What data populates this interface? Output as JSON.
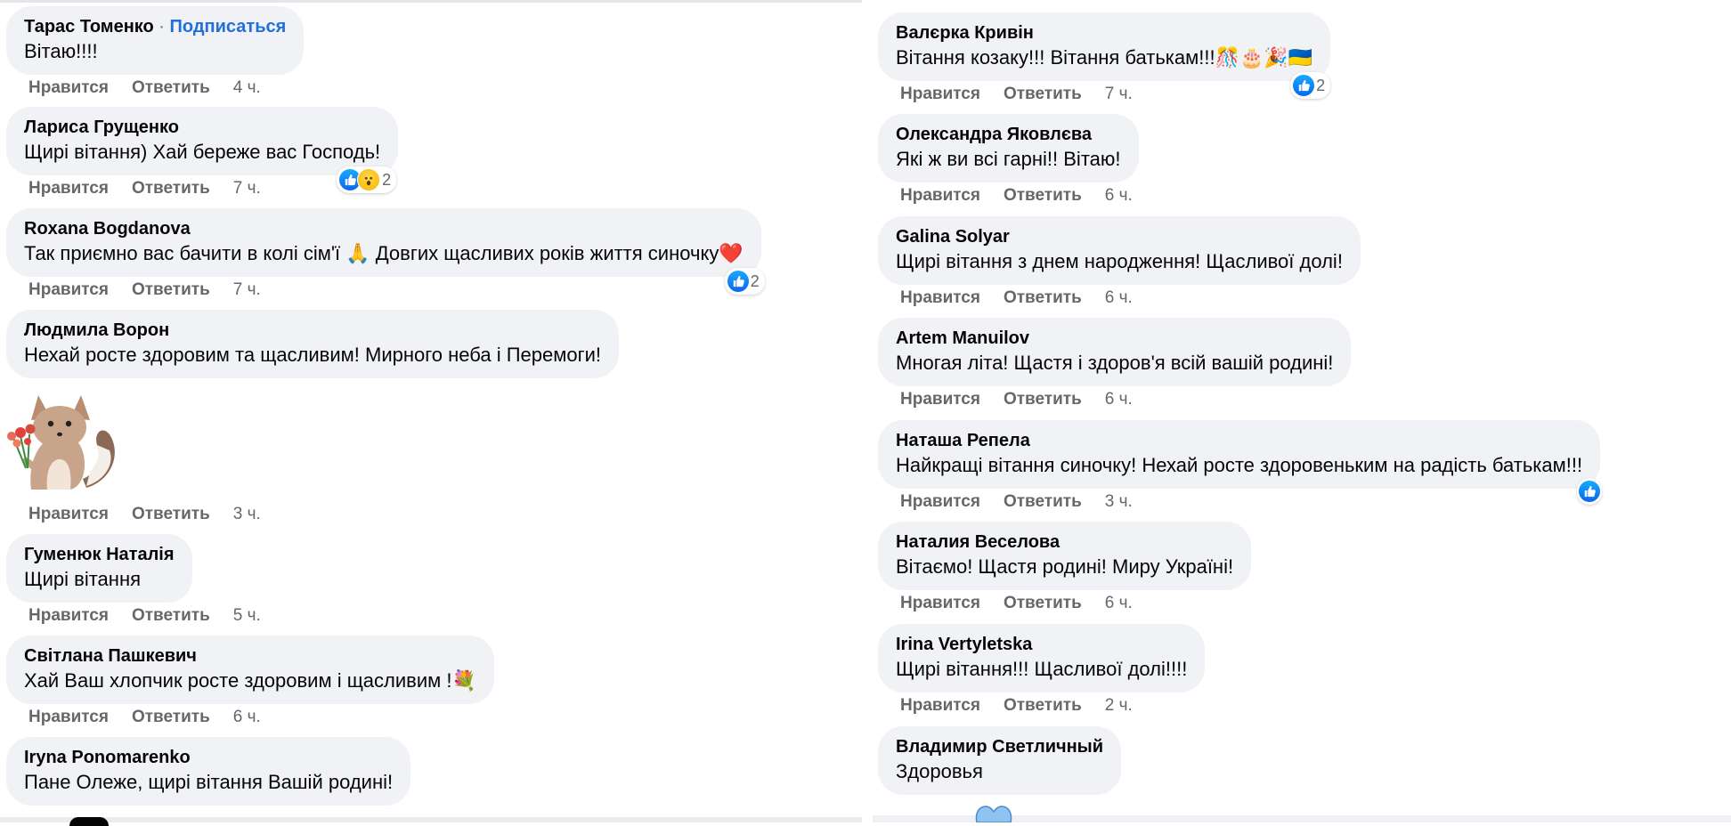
{
  "left": {
    "comments": [
      {
        "author": "Тарас Томенко",
        "subscribe": "Подписаться",
        "sep": "·",
        "text": "Вітаю!!!!",
        "like": "Нравится",
        "reply": "Ответить",
        "time": "4 ч."
      },
      {
        "author": "Лариса Грущенко",
        "text": "Щирі вітання) Хай береже вас Господь!",
        "like": "Нравится",
        "reply": "Ответить",
        "time": "7 ч.",
        "reaction_count": "2"
      },
      {
        "author": "Roxana Bogdanova",
        "text": "Так приємно вас бачити в колі сім'ї 🙏 Довгих щасливих років життя синочку❤️",
        "like": "Нравится",
        "reply": "Ответить",
        "time": "7 ч.",
        "reaction_count": "2"
      },
      {
        "author": "Людмила Ворон",
        "text": "Нехай росте здоровим та щасливим! Мирного неба і Перемоги!"
      },
      {
        "like": "Нравится",
        "reply": "Ответить",
        "time": "3 ч."
      },
      {
        "author": "Гуменюк Наталія",
        "text": "Щирі вітання",
        "like": "Нравится",
        "reply": "Ответить",
        "time": "5 ч."
      },
      {
        "author": "Світлана Пашкевич",
        "text": "Хай Ваш хлопчик росте здоровим і щасливим !💐",
        "like": "Нравится",
        "reply": "Ответить",
        "time": "6 ч."
      },
      {
        "author": "Iryna Ponomarenko",
        "text": "Пане Олеже, щирі вітання Вашій родині!"
      }
    ]
  },
  "right": {
    "comments": [
      {
        "author": "Валєрка Кривін",
        "text": "Вітання козаку!!! Вітання батькам!!!🎊🎂🎉🇺🇦",
        "like": "Нравится",
        "reply": "Ответить",
        "time": "7 ч.",
        "reaction_count": "2"
      },
      {
        "author": "Олександра Яковлєва",
        "text": "Які ж ви всі гарні!! Вітаю!",
        "like": "Нравится",
        "reply": "Ответить",
        "time": "6 ч."
      },
      {
        "author": "Galina Solyar",
        "text": "Щирі вітання з днем народження! Щасливої долі!",
        "like": "Нравится",
        "reply": "Ответить",
        "time": "6 ч."
      },
      {
        "author": "Artem Manuilov",
        "text": "Многая літа! Щастя і здоров'я всій вашій родині!",
        "like": "Нравится",
        "reply": "Ответить",
        "time": "6 ч."
      },
      {
        "author": "Наташа Репела",
        "text": "Найкращі вітання синочку! Нехай росте здоровеньким на радість батькам!!!",
        "like": "Нравится",
        "reply": "Ответить",
        "time": "3 ч."
      },
      {
        "author": "Наталия Веселова",
        "text": "Вітаємо! Щастя родині! Миру Україні!",
        "like": "Нравится",
        "reply": "Ответить",
        "time": "6 ч."
      },
      {
        "author": "Irina Vertyletska",
        "text": "Щирі вітання!!! Щасливої долі!!!!",
        "like": "Нравится",
        "reply": "Ответить",
        "time": "2 ч."
      },
      {
        "author": "Владимир Светличный",
        "text": "Здоровья"
      }
    ]
  },
  "colors": {
    "bubble": "#f0f2f5",
    "link": "#216fdb",
    "meta": "#65676b",
    "like": "#0a66ec"
  },
  "icons": {
    "like": "thumbs-up-icon",
    "wow": "wow-face-icon",
    "sticker": "fox-with-flowers-sticker"
  }
}
